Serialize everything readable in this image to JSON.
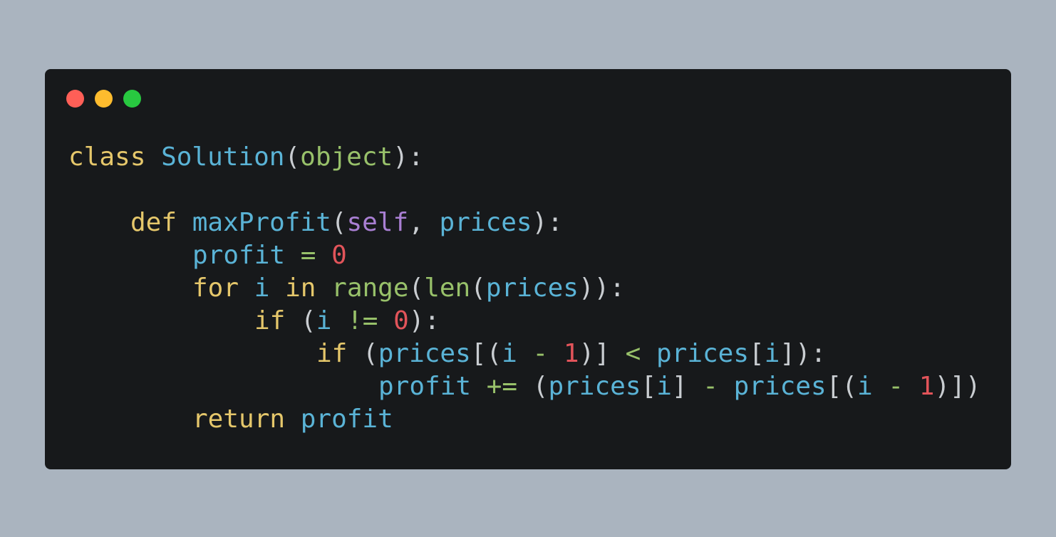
{
  "window": {
    "controls": [
      {
        "name": "close",
        "color": "#ff5f57"
      },
      {
        "name": "minimize",
        "color": "#febc2e"
      },
      {
        "name": "maximize",
        "color": "#28c840"
      }
    ]
  },
  "colors": {
    "background": "#aab4bf",
    "editor": "#17191b",
    "keyword": "#e5c76b",
    "name": "#5ab3d6",
    "builtin": "#98c16a",
    "self": "#a97fd3",
    "number": "#e2545a",
    "punct": "#c9cdd1",
    "operator": "#98c16a"
  },
  "code": {
    "lines": [
      [
        {
          "t": "class",
          "c": "keyword"
        },
        {
          "t": " ",
          "c": "punct"
        },
        {
          "t": "Solution",
          "c": "name"
        },
        {
          "t": "(",
          "c": "punct"
        },
        {
          "t": "object",
          "c": "builtin"
        },
        {
          "t": "):",
          "c": "punct"
        }
      ],
      [],
      [
        {
          "t": "def",
          "c": "keyword"
        },
        {
          "t": " ",
          "c": "punct"
        },
        {
          "t": "maxProfit",
          "c": "name"
        },
        {
          "t": "(",
          "c": "punct"
        },
        {
          "t": "self",
          "c": "self"
        },
        {
          "t": ", ",
          "c": "punct"
        },
        {
          "t": "prices",
          "c": "name"
        },
        {
          "t": "):",
          "c": "punct"
        }
      ],
      [
        {
          "t": "profit",
          "c": "name"
        },
        {
          "t": " ",
          "c": "punct"
        },
        {
          "t": "=",
          "c": "operator"
        },
        {
          "t": " ",
          "c": "punct"
        },
        {
          "t": "0",
          "c": "number"
        }
      ],
      [
        {
          "t": "for",
          "c": "keyword"
        },
        {
          "t": " ",
          "c": "punct"
        },
        {
          "t": "i",
          "c": "name"
        },
        {
          "t": " ",
          "c": "punct"
        },
        {
          "t": "in",
          "c": "keyword"
        },
        {
          "t": " ",
          "c": "punct"
        },
        {
          "t": "range",
          "c": "builtin"
        },
        {
          "t": "(",
          "c": "punct"
        },
        {
          "t": "len",
          "c": "builtin"
        },
        {
          "t": "(",
          "c": "punct"
        },
        {
          "t": "prices",
          "c": "name"
        },
        {
          "t": ")):",
          "c": "punct"
        }
      ],
      [
        {
          "t": "if",
          "c": "keyword"
        },
        {
          "t": " (",
          "c": "punct"
        },
        {
          "t": "i",
          "c": "name"
        },
        {
          "t": " ",
          "c": "punct"
        },
        {
          "t": "!=",
          "c": "operator"
        },
        {
          "t": " ",
          "c": "punct"
        },
        {
          "t": "0",
          "c": "number"
        },
        {
          "t": "):",
          "c": "punct"
        }
      ],
      [
        {
          "t": "if",
          "c": "keyword"
        },
        {
          "t": " (",
          "c": "punct"
        },
        {
          "t": "prices",
          "c": "name"
        },
        {
          "t": "[(",
          "c": "punct"
        },
        {
          "t": "i",
          "c": "name"
        },
        {
          "t": " ",
          "c": "punct"
        },
        {
          "t": "-",
          "c": "operator"
        },
        {
          "t": " ",
          "c": "punct"
        },
        {
          "t": "1",
          "c": "number"
        },
        {
          "t": ")]",
          "c": "punct"
        },
        {
          "t": " ",
          "c": "punct"
        },
        {
          "t": "<",
          "c": "operator"
        },
        {
          "t": " ",
          "c": "punct"
        },
        {
          "t": "prices",
          "c": "name"
        },
        {
          "t": "[",
          "c": "punct"
        },
        {
          "t": "i",
          "c": "name"
        },
        {
          "t": "]):",
          "c": "punct"
        }
      ],
      [
        {
          "t": "profit",
          "c": "name"
        },
        {
          "t": " ",
          "c": "punct"
        },
        {
          "t": "+=",
          "c": "operator"
        },
        {
          "t": " (",
          "c": "punct"
        },
        {
          "t": "prices",
          "c": "name"
        },
        {
          "t": "[",
          "c": "punct"
        },
        {
          "t": "i",
          "c": "name"
        },
        {
          "t": "]",
          "c": "punct"
        },
        {
          "t": " ",
          "c": "punct"
        },
        {
          "t": "-",
          "c": "operator"
        },
        {
          "t": " ",
          "c": "punct"
        },
        {
          "t": "prices",
          "c": "name"
        },
        {
          "t": "[(",
          "c": "punct"
        },
        {
          "t": "i",
          "c": "name"
        },
        {
          "t": " ",
          "c": "punct"
        },
        {
          "t": "-",
          "c": "operator"
        },
        {
          "t": " ",
          "c": "punct"
        },
        {
          "t": "1",
          "c": "number"
        },
        {
          "t": ")])",
          "c": "punct"
        }
      ],
      [
        {
          "t": "return",
          "c": "keyword"
        },
        {
          "t": " ",
          "c": "punct"
        },
        {
          "t": "profit",
          "c": "name"
        }
      ]
    ]
  }
}
